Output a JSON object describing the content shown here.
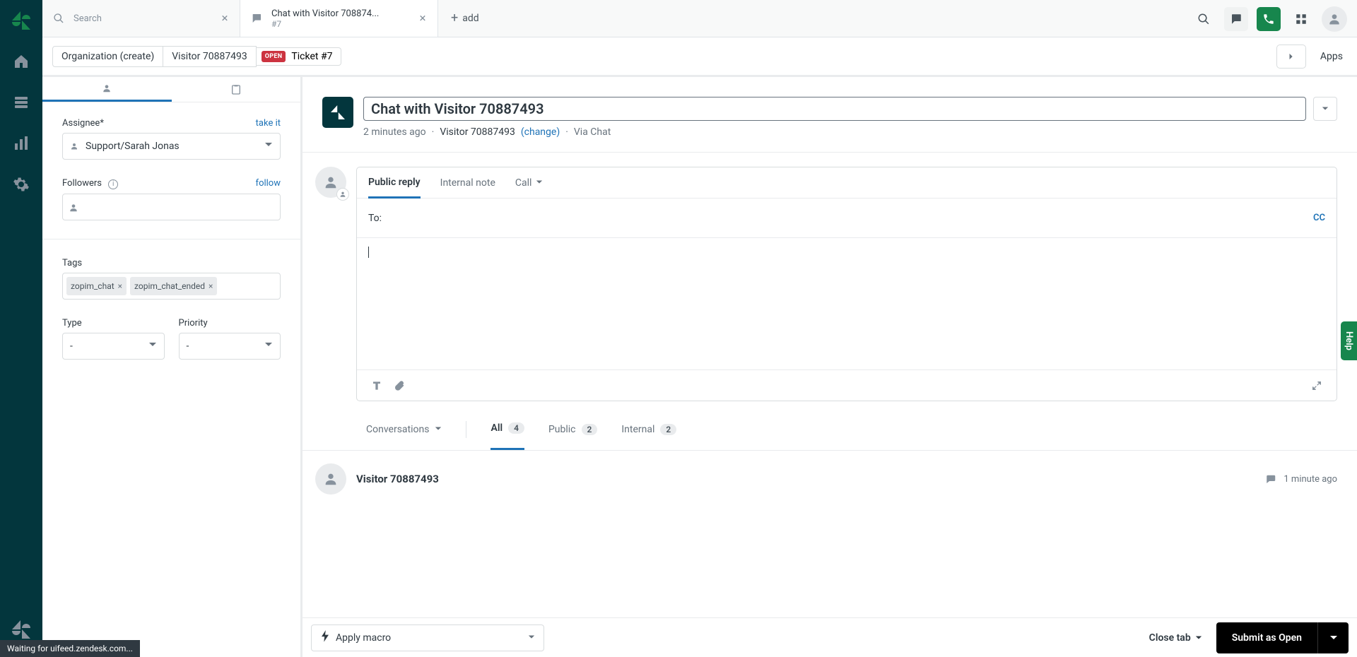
{
  "tabs": {
    "search": {
      "placeholder": "Search"
    },
    "ticket": {
      "title": "Chat with Visitor 708874...",
      "subtitle": "#7"
    },
    "add_label": "add"
  },
  "secondary": {
    "org_create": "Organization (create)",
    "requester": "Visitor 70887493",
    "status_chip": "OPEN",
    "ticket_ref": "Ticket #7",
    "apps": "Apps"
  },
  "left": {
    "assignee_label": "Assignee*",
    "take_it": "take it",
    "assignee_value": "Support/Sarah Jonas",
    "followers_label": "Followers",
    "follow": "follow",
    "tags_label": "Tags",
    "tags": [
      "zopim_chat",
      "zopim_chat_ended"
    ],
    "type_label": "Type",
    "type_value": "-",
    "priority_label": "Priority",
    "priority_value": "-"
  },
  "ticket": {
    "subject": "Chat with Visitor 70887493",
    "meta_time": "2 minutes ago",
    "meta_requester": "Visitor 70887493",
    "meta_change": "(change)",
    "meta_via": "Via Chat"
  },
  "composer": {
    "tab_public": "Public reply",
    "tab_internal": "Internal note",
    "tab_call": "Call",
    "to_label": "To:",
    "cc": "CC"
  },
  "filters": {
    "conversations": "Conversations",
    "all": "All",
    "all_n": "4",
    "public": "Public",
    "public_n": "2",
    "internal": "Internal",
    "internal_n": "2"
  },
  "events": {
    "visitor_name": "Visitor 70887493",
    "time": "1 minute ago"
  },
  "bottom": {
    "macro": "Apply macro",
    "close_tab": "Close tab",
    "submit": "Submit as Open"
  },
  "status_toast": "Waiting for uifeed.zendesk.com...",
  "help": "Help"
}
